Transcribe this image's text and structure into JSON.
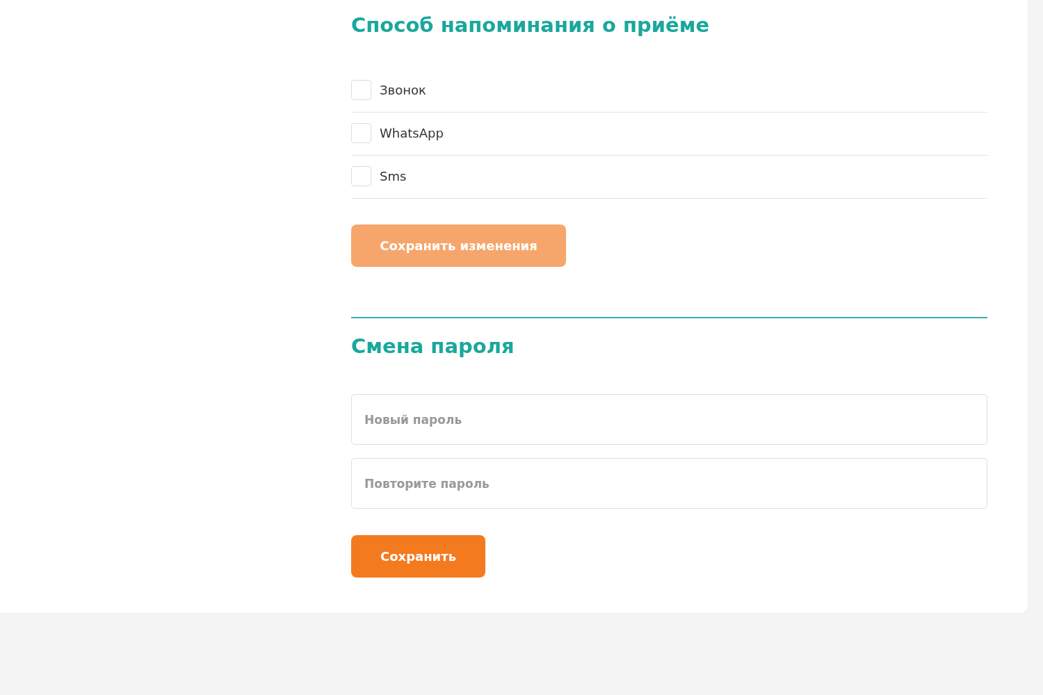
{
  "reminder_section": {
    "title": "Способ напоминания о приёме",
    "options": [
      {
        "label": "Звонок",
        "checked": false
      },
      {
        "label": "WhatsApp",
        "checked": false
      },
      {
        "label": "Sms",
        "checked": false
      }
    ],
    "save_button": {
      "label": "Сохранить изменения",
      "disabled": true
    }
  },
  "password_section": {
    "title": "Смена пароля",
    "fields": [
      {
        "placeholder": "Новый пароль"
      },
      {
        "placeholder": "Повторите пароль"
      }
    ],
    "save_button": {
      "label": "Сохранить",
      "disabled": false
    }
  }
}
